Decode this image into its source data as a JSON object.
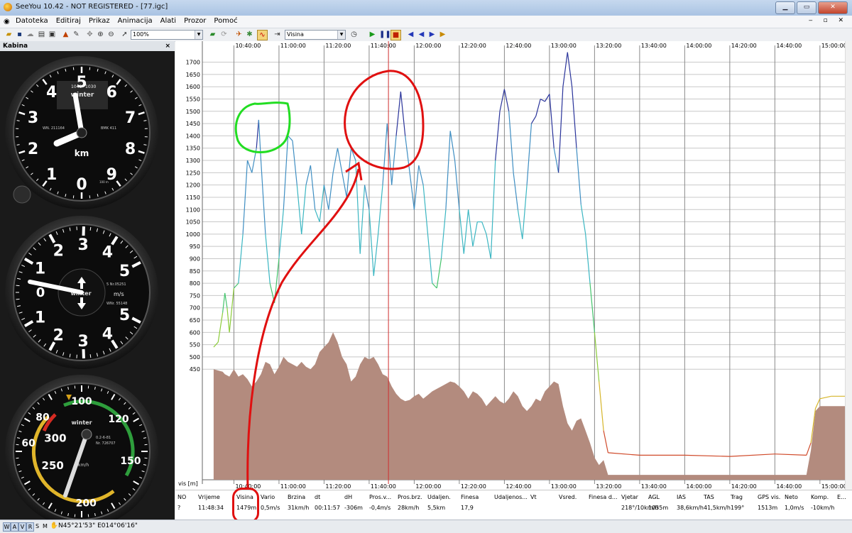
{
  "window": {
    "title": "SeeYou 10.42 - NOT REGISTERED - [77.igc]"
  },
  "menu": {
    "items": [
      "Datoteka",
      "Editiraj",
      "Prikaz",
      "Animacija",
      "Alati",
      "Prozor",
      "Pomoć"
    ]
  },
  "toolbar": {
    "zoom_value": "100%",
    "parameter_value": "Visina"
  },
  "panel": {
    "title": "Kabina",
    "close": "×"
  },
  "gauges": {
    "altimeter": {
      "digits": [
        "0",
        "1",
        "2",
        "3",
        "4",
        "5",
        "6",
        "7",
        "8",
        "9"
      ],
      "unit": "km",
      "small": [
        "1020",
        "1030",
        "1040"
      ],
      "serial_left": "WN. 211164",
      "serial_right": "BMK 411",
      "brand": "winter",
      "scale_mark": "100 m"
    },
    "vario": {
      "labels_top": [
        "1",
        "2",
        "3",
        "4",
        "5"
      ],
      "labels_bottom": [
        "1",
        "2",
        "3",
        "4",
        "5"
      ],
      "zero": "0",
      "unit": "m/s",
      "serial1": "5 Nr.05251",
      "serial2": "WNr. 55148",
      "brand": "winter"
    },
    "airspeed": {
      "labels": [
        "60",
        "80",
        "100",
        "120",
        "150",
        "200",
        "250",
        "300"
      ],
      "unit": "km/h",
      "serial1": "0.2-6-81",
      "serial2": "Nr. 726707",
      "brand": "winter"
    }
  },
  "chart_data": {
    "type": "line",
    "title": "",
    "ylabel": "vis [m]",
    "ylim": [
      0,
      1750
    ],
    "yticks": [
      450,
      500,
      550,
      600,
      650,
      700,
      750,
      800,
      850,
      900,
      950,
      1000,
      1050,
      1100,
      1150,
      1200,
      1250,
      1300,
      1350,
      1400,
      1450,
      1500,
      1550,
      1600,
      1650,
      1700
    ],
    "xticks": [
      "10:40:00",
      "11:00:00",
      "11:20:00",
      "11:40:00",
      "12:00:00",
      "12:20:00",
      "12:40:00",
      "13:00:00",
      "13:20:00",
      "13:40:00",
      "14:00:00",
      "14:20:00",
      "14:40:00",
      "15:00:00"
    ],
    "cursor_time": "11:48:34",
    "series": [
      {
        "kind": "altitude",
        "points": [
          [
            "10:31:00",
            540
          ],
          [
            "10:33:00",
            560
          ],
          [
            "10:35:00",
            680
          ],
          [
            "10:36:00",
            760
          ],
          [
            "10:37:00",
            700
          ],
          [
            "10:38:00",
            600
          ],
          [
            "10:40:00",
            780
          ],
          [
            "10:42:00",
            800
          ],
          [
            "10:44:00",
            1000
          ],
          [
            "10:46:00",
            1300
          ],
          [
            "10:48:00",
            1250
          ],
          [
            "10:50:00",
            1350
          ],
          [
            "10:51:00",
            1465
          ],
          [
            "10:52:00",
            1300
          ],
          [
            "10:54:00",
            1000
          ],
          [
            "10:56:00",
            800
          ],
          [
            "10:58:00",
            720
          ],
          [
            "11:00:00",
            900
          ],
          [
            "11:02:00",
            1100
          ],
          [
            "11:04:00",
            1400
          ],
          [
            "11:06:00",
            1380
          ],
          [
            "11:08:00",
            1200
          ],
          [
            "11:10:00",
            1000
          ],
          [
            "11:12:00",
            1200
          ],
          [
            "11:14:00",
            1280
          ],
          [
            "11:16:00",
            1100
          ],
          [
            "11:18:00",
            1050
          ],
          [
            "11:20:00",
            1200
          ],
          [
            "11:22:00",
            1100
          ],
          [
            "11:24:00",
            1250
          ],
          [
            "11:26:00",
            1350
          ],
          [
            "11:28:00",
            1250
          ],
          [
            "11:30:00",
            1150
          ],
          [
            "11:32:00",
            1350
          ],
          [
            "11:34:00",
            1300
          ],
          [
            "11:36:00",
            920
          ],
          [
            "11:38:00",
            1200
          ],
          [
            "11:40:00",
            1100
          ],
          [
            "11:42:00",
            830
          ],
          [
            "11:44:00",
            1000
          ],
          [
            "11:46:00",
            1200
          ],
          [
            "11:48:00",
            1450
          ],
          [
            "11:50:00",
            1200
          ],
          [
            "11:52:00",
            1400
          ],
          [
            "11:54:00",
            1580
          ],
          [
            "11:56:00",
            1400
          ],
          [
            "11:58:00",
            1250
          ],
          [
            "12:00:00",
            1100
          ],
          [
            "12:02:00",
            1280
          ],
          [
            "12:04:00",
            1200
          ],
          [
            "12:06:00",
            1000
          ],
          [
            "12:08:00",
            800
          ],
          [
            "12:10:00",
            780
          ],
          [
            "12:12:00",
            900
          ],
          [
            "12:14:00",
            1100
          ],
          [
            "12:16:00",
            1420
          ],
          [
            "12:18:00",
            1300
          ],
          [
            "12:20:00",
            1100
          ],
          [
            "12:22:00",
            920
          ],
          [
            "12:24:00",
            1100
          ],
          [
            "12:26:00",
            950
          ],
          [
            "12:28:00",
            1050
          ],
          [
            "12:30:00",
            1050
          ],
          [
            "12:32:00",
            1000
          ],
          [
            "12:34:00",
            900
          ],
          [
            "12:36:00",
            1300
          ],
          [
            "12:38:00",
            1500
          ],
          [
            "12:40:00",
            1590
          ],
          [
            "12:42:00",
            1500
          ],
          [
            "12:44:00",
            1250
          ],
          [
            "12:46:00",
            1100
          ],
          [
            "12:48:00",
            980
          ],
          [
            "12:50:00",
            1200
          ],
          [
            "12:52:00",
            1450
          ],
          [
            "12:54:00",
            1480
          ],
          [
            "12:56:00",
            1550
          ],
          [
            "12:58:00",
            1540
          ],
          [
            "13:00:00",
            1570
          ],
          [
            "13:02:00",
            1350
          ],
          [
            "13:04:00",
            1250
          ],
          [
            "13:06:00",
            1600
          ],
          [
            "13:08:00",
            1740
          ],
          [
            "13:10:00",
            1600
          ],
          [
            "13:12:00",
            1350
          ],
          [
            "13:14:00",
            1120
          ],
          [
            "13:16:00",
            1000
          ],
          [
            "13:18:00",
            800
          ],
          [
            "13:20:00",
            600
          ],
          [
            "13:22:00",
            400
          ],
          [
            "13:24:00",
            200
          ],
          [
            "13:26:00",
            110
          ],
          [
            "13:40:00",
            100
          ],
          [
            "14:00:00",
            100
          ],
          [
            "14:20:00",
            95
          ],
          [
            "14:40:00",
            105
          ],
          [
            "14:54:00",
            100
          ],
          [
            "14:56:00",
            150
          ],
          [
            "14:58:00",
            290
          ],
          [
            "15:00:00",
            330
          ],
          [
            "15:05:00",
            340
          ]
        ]
      },
      {
        "kind": "terrain",
        "points": [
          [
            "10:31:00",
            450
          ],
          [
            "10:35:00",
            440
          ],
          [
            "10:36:00",
            430
          ],
          [
            "10:38:00",
            420
          ],
          [
            "10:40:00",
            450
          ],
          [
            "10:42:00",
            420
          ],
          [
            "10:44:00",
            430
          ],
          [
            "10:46:00",
            410
          ],
          [
            "10:48:00",
            380
          ],
          [
            "10:50:00",
            400
          ],
          [
            "10:52:00",
            430
          ],
          [
            "10:54:00",
            480
          ],
          [
            "10:56:00",
            470
          ],
          [
            "10:58:00",
            430
          ],
          [
            "11:00:00",
            460
          ],
          [
            "11:02:00",
            500
          ],
          [
            "11:04:00",
            480
          ],
          [
            "11:06:00",
            470
          ],
          [
            "11:08:00",
            460
          ],
          [
            "11:10:00",
            480
          ],
          [
            "11:12:00",
            460
          ],
          [
            "11:14:00",
            450
          ],
          [
            "11:16:00",
            470
          ],
          [
            "11:18:00",
            520
          ],
          [
            "11:20:00",
            540
          ],
          [
            "11:22:00",
            560
          ],
          [
            "11:24:00",
            600
          ],
          [
            "11:26:00",
            560
          ],
          [
            "11:28:00",
            500
          ],
          [
            "11:30:00",
            470
          ],
          [
            "11:32:00",
            400
          ],
          [
            "11:34:00",
            420
          ],
          [
            "11:36:00",
            470
          ],
          [
            "11:38:00",
            500
          ],
          [
            "11:40:00",
            490
          ],
          [
            "11:42:00",
            500
          ],
          [
            "11:44:00",
            470
          ],
          [
            "11:46:00",
            430
          ],
          [
            "11:48:00",
            420
          ],
          [
            "11:50:00",
            380
          ],
          [
            "11:52:00",
            350
          ],
          [
            "11:54:00",
            330
          ],
          [
            "11:56:00",
            320
          ],
          [
            "11:58:00",
            325
          ],
          [
            "12:00:00",
            340
          ],
          [
            "12:02:00",
            350
          ],
          [
            "12:04:00",
            330
          ],
          [
            "12:06:00",
            345
          ],
          [
            "12:08:00",
            360
          ],
          [
            "12:10:00",
            370
          ],
          [
            "12:12:00",
            380
          ],
          [
            "12:14:00",
            390
          ],
          [
            "12:16:00",
            400
          ],
          [
            "12:18:00",
            395
          ],
          [
            "12:20:00",
            380
          ],
          [
            "12:22:00",
            360
          ],
          [
            "12:24:00",
            330
          ],
          [
            "12:26:00",
            360
          ],
          [
            "12:28:00",
            350
          ],
          [
            "12:30:00",
            330
          ],
          [
            "12:32:00",
            300
          ],
          [
            "12:34:00",
            320
          ],
          [
            "12:36:00",
            340
          ],
          [
            "12:38:00",
            320
          ],
          [
            "12:40:00",
            310
          ],
          [
            "12:42:00",
            330
          ],
          [
            "12:44:00",
            360
          ],
          [
            "12:46:00",
            340
          ],
          [
            "12:48:00",
            300
          ],
          [
            "12:50:00",
            280
          ],
          [
            "12:52:00",
            300
          ],
          [
            "12:54:00",
            330
          ],
          [
            "12:56:00",
            320
          ],
          [
            "12:58:00",
            360
          ],
          [
            "13:00:00",
            380
          ],
          [
            "13:02:00",
            400
          ],
          [
            "13:04:00",
            390
          ],
          [
            "13:06:00",
            300
          ],
          [
            "13:08:00",
            230
          ],
          [
            "13:10:00",
            200
          ],
          [
            "13:12:00",
            240
          ],
          [
            "13:14:00",
            250
          ],
          [
            "13:16:00",
            200
          ],
          [
            "13:18:00",
            150
          ],
          [
            "13:20:00",
            90
          ],
          [
            "13:22:00",
            60
          ],
          [
            "13:24:00",
            80
          ],
          [
            "13:26:00",
            20
          ],
          [
            "15:00:00",
            20
          ],
          [
            "14:54:00",
            20
          ],
          [
            "14:56:00",
            120
          ],
          [
            "14:58:00",
            280
          ],
          [
            "15:00:00",
            300
          ],
          [
            "15:05:00",
            300
          ]
        ]
      }
    ]
  },
  "info_table": {
    "headers": [
      "NO",
      "Vrijeme",
      "Visina",
      "Vario",
      "Brzina",
      "dt",
      "dH",
      "Pros.v...",
      "Pros.brz.",
      "Udaljen.",
      "Finesa",
      "Udaljenos...",
      "Vt",
      "Vsred.",
      "Finesa d...",
      "Vjetar",
      "AGL",
      "IAS",
      "TAS",
      "Trag",
      "GPS vis.",
      "Neto",
      "Komp.",
      "E..."
    ],
    "values": [
      "?",
      "11:48:34",
      "1479m",
      "0,5m/s",
      "31km/h",
      "00:11:57",
      "-306m",
      "-0,4m/s",
      "28km/h",
      "5,5km",
      "17,9",
      "",
      "",
      "",
      "",
      "218°/10km/h",
      "1035m",
      "38,6km/h",
      "41,5km/h",
      "199°",
      "1513m",
      "1,0m/s",
      "-10km/h",
      ""
    ]
  },
  "statusbar": {
    "modes": [
      "W",
      "A",
      "V",
      "R",
      "S",
      "M"
    ],
    "coords": "N45°21'53\" E014°06'16\""
  },
  "colors": {
    "terrain": "#b38b7e",
    "cursor": "#d03030",
    "annotation_red": "#e01010",
    "annotation_green": "#22dd22"
  }
}
